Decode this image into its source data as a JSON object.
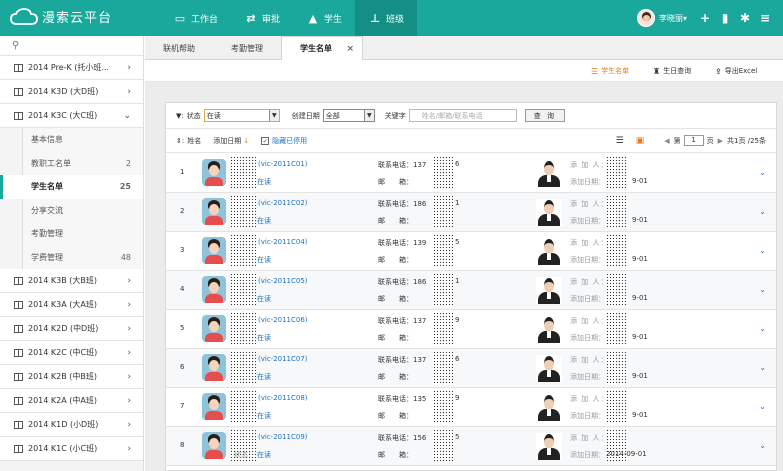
{
  "app": {
    "name": "漫索云平台"
  },
  "nav": [
    {
      "icon": "monitor-icon",
      "glyph": "▭",
      "label": "工作台"
    },
    {
      "icon": "shuffle-icon",
      "glyph": "⇄",
      "label": "审批"
    },
    {
      "icon": "graduation-cap-icon",
      "glyph": "🎓",
      "label": "学生"
    },
    {
      "icon": "org-chart-icon",
      "glyph": "品",
      "label": "班级"
    }
  ],
  "user": {
    "name": "李晓丽▾"
  },
  "sidebar": {
    "classes_top": [
      {
        "label": "2014 Pre-K (托小班..."
      },
      {
        "label": "2014 K3D (大D班)"
      },
      {
        "label": "2014 K3C (大C班)"
      }
    ],
    "sub_items": [
      {
        "label": "基本信息",
        "count": ""
      },
      {
        "label": "教职工名单",
        "count": "2"
      },
      {
        "label": "学生名单",
        "count": "25"
      },
      {
        "label": "分享交流",
        "count": ""
      },
      {
        "label": "考勤管理",
        "count": ""
      },
      {
        "label": "学费管理",
        "count": "48"
      }
    ],
    "classes_bottom": [
      {
        "label": "2014 K3B (大B班)"
      },
      {
        "label": "2014 K3A (大A班)"
      },
      {
        "label": "2014 K2D (中D班)"
      },
      {
        "label": "2014 K2C (中C班)"
      },
      {
        "label": "2014 K2B (中B班)"
      },
      {
        "label": "2014 K2A (中A班)"
      },
      {
        "label": "2014 K1D (小D班)"
      },
      {
        "label": "2014 K1C (小C班)"
      }
    ]
  },
  "tabs": [
    {
      "label": "联机帮助"
    },
    {
      "label": "考勤管理"
    },
    {
      "label": "学生名单",
      "close": "×"
    }
  ],
  "toolbar": {
    "student_list": "学生名单",
    "birthday_query": "生日查询",
    "export_excel": "导出Excel"
  },
  "filter": {
    "status_label": "状态",
    "status_value": "在读",
    "created_label": "创建日期",
    "created_value": "全部",
    "keyword_label": "关键字",
    "keyword_placeholder": "姓名/邮箱/联系电话",
    "query_button": "查 询"
  },
  "controls": {
    "sort_label": "姓名",
    "add_date": "添加日期",
    "hide_disabled": "隐藏已停用",
    "page_label_pre": "第",
    "page_value": "1",
    "page_label_post": "页",
    "page_total": "共1页 /25条"
  },
  "labels": {
    "tel": "联系电话：",
    "email": "邮　　箱：",
    "adder": "添 加 人：",
    "add_date": "添加日期：",
    "status": "状态："
  },
  "students": [
    {
      "num": "1",
      "code": "(vic-2011C01)",
      "status": "在读",
      "tel": "137",
      "tel_tail": "6",
      "date": "9-01"
    },
    {
      "num": "2",
      "code": "(vic-2011C02)",
      "status": "在读",
      "tel": "186",
      "tel_tail": "1",
      "date": "9-01"
    },
    {
      "num": "3",
      "code": "(vic-2011C04)",
      "status": "在读",
      "tel": "139",
      "tel_tail": "5",
      "date": "9-01"
    },
    {
      "num": "4",
      "code": "(vic-2011C05)",
      "status": "在读",
      "tel": "186",
      "tel_tail": "1",
      "date": "9-01"
    },
    {
      "num": "5",
      "code": "(vic-2011C06)",
      "status": "在读",
      "tel": "137",
      "tel_tail": "9",
      "date": "9-01"
    },
    {
      "num": "6",
      "code": "(vic-2011C07)",
      "status": "在读",
      "tel": "137",
      "tel_tail": "6",
      "date": "9-01"
    },
    {
      "num": "7",
      "code": "(vic-2011C08)",
      "status": "在读",
      "tel": "135",
      "tel_tail": "9",
      "date": "9-01"
    },
    {
      "num": "8",
      "code": "(vic-2011C09)",
      "status": "在读",
      "tel": "156",
      "tel_tail": "5",
      "date": "2014-09-01"
    }
  ],
  "colors": {
    "brand": "#1aa89c",
    "link": "#1a73c8",
    "accent": "#e77b1c"
  }
}
